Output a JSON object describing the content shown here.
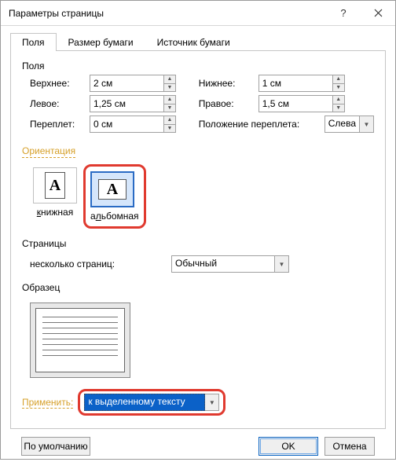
{
  "title": "Параметры страницы",
  "tabs": {
    "fields": "Поля",
    "size": "Размер бумаги",
    "source": "Источник бумаги"
  },
  "margins": {
    "section_label": "Поля",
    "top_label": "Верхнее:",
    "top_value": "2 см",
    "left_label": "Левое:",
    "left_value": "1,25 см",
    "gutter_label": "Переплет:",
    "gutter_value": "0 см",
    "bottom_label": "Нижнее:",
    "bottom_value": "1 см",
    "right_label": "Правое:",
    "right_value": "1,5 см",
    "gutter_pos_label": "Положение переплета:",
    "gutter_pos_value": "Слева"
  },
  "orientation": {
    "label": "Ориентация",
    "portrait": "книжная",
    "landscape": "альбомная",
    "glyph": "A"
  },
  "pages": {
    "label": "Страницы",
    "multi_label": "несколько страниц:",
    "multi_value": "Обычный"
  },
  "sample": {
    "label": "Образец"
  },
  "apply": {
    "label": "Применить:",
    "value": "к выделенному тексту"
  },
  "buttons": {
    "defaults": "По умолчанию",
    "ok": "OK",
    "cancel": "Отмена"
  }
}
